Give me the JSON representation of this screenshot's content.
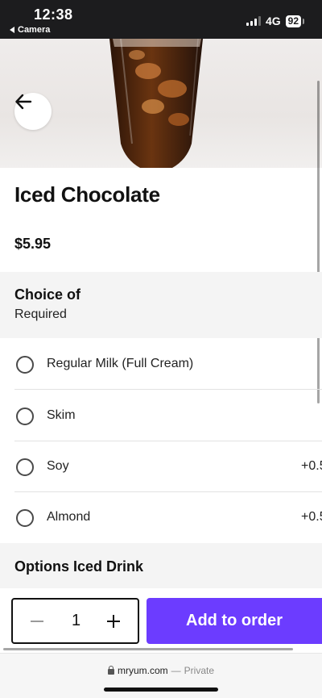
{
  "status_bar": {
    "time": "12:38",
    "back_label": "Camera",
    "network": "4G",
    "battery": "92"
  },
  "product": {
    "title": "Iced Chocolate",
    "price": "$5.95"
  },
  "choice_section": {
    "title": "Choice of",
    "subtitle": "Required",
    "options": [
      {
        "label": "Regular Milk (Full Cream)",
        "price": ""
      },
      {
        "label": "Skim",
        "price": ""
      },
      {
        "label": "Soy",
        "price": "+0.5"
      },
      {
        "label": "Almond",
        "price": "+0.5"
      }
    ]
  },
  "options_section": {
    "title": "Options Iced Drink"
  },
  "order_bar": {
    "quantity": "1",
    "add_label": "Add to order"
  },
  "browser": {
    "domain": "mryum.com",
    "separator": "—",
    "mode": "Private"
  },
  "colors": {
    "accent": "#6c3cff",
    "status_bar": "#1c1c1e"
  },
  "icons": {
    "back": "arrow-left-icon",
    "lock": "lock-icon"
  }
}
